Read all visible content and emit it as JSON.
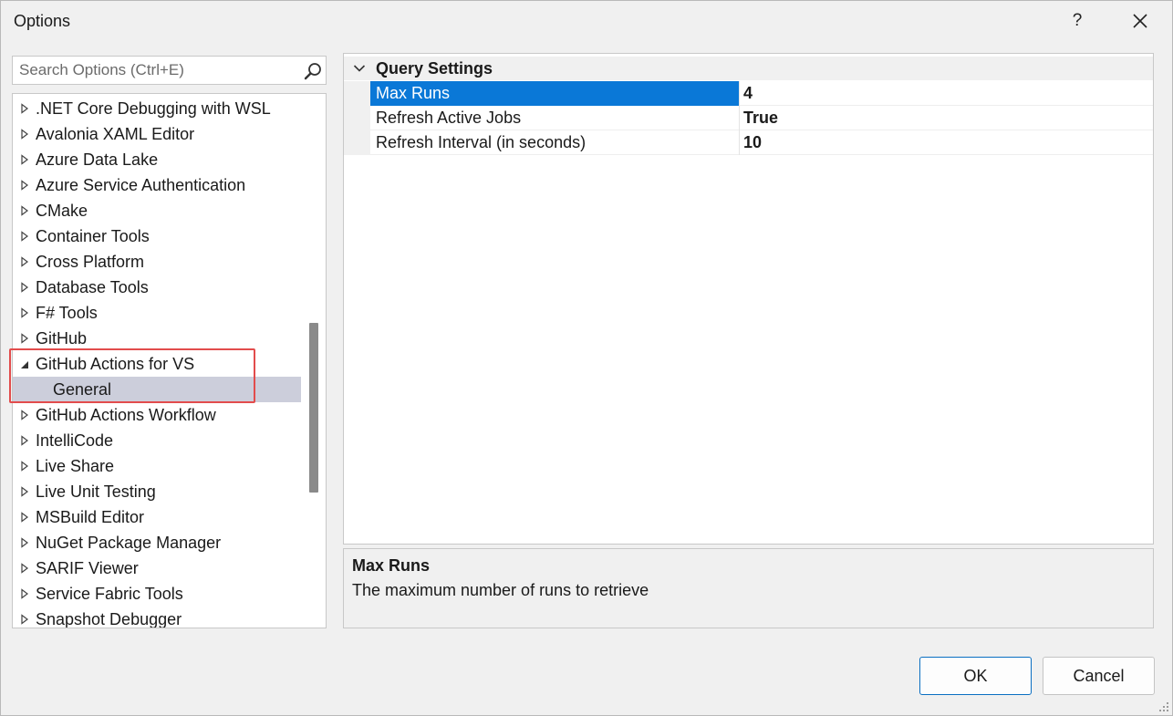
{
  "window": {
    "title": "Options",
    "help_glyph": "?"
  },
  "search": {
    "placeholder": "Search Options (Ctrl+E)"
  },
  "tree": {
    "items": [
      {
        "label": ".NET Core Debugging with WSL",
        "state": "collapsed"
      },
      {
        "label": "Avalonia XAML Editor",
        "state": "collapsed"
      },
      {
        "label": "Azure Data Lake",
        "state": "collapsed"
      },
      {
        "label": "Azure Service Authentication",
        "state": "collapsed"
      },
      {
        "label": "CMake",
        "state": "collapsed"
      },
      {
        "label": "Container Tools",
        "state": "collapsed"
      },
      {
        "label": "Cross Platform",
        "state": "collapsed"
      },
      {
        "label": "Database Tools",
        "state": "collapsed"
      },
      {
        "label": "F# Tools",
        "state": "collapsed"
      },
      {
        "label": "GitHub",
        "state": "collapsed"
      },
      {
        "label": "GitHub Actions for VS",
        "state": "expanded"
      },
      {
        "label": "General",
        "state": "child-selected"
      },
      {
        "label": "GitHub Actions Workflow",
        "state": "collapsed"
      },
      {
        "label": "IntelliCode",
        "state": "collapsed"
      },
      {
        "label": "Live Share",
        "state": "collapsed"
      },
      {
        "label": "Live Unit Testing",
        "state": "collapsed"
      },
      {
        "label": "MSBuild Editor",
        "state": "collapsed"
      },
      {
        "label": "NuGet Package Manager",
        "state": "collapsed"
      },
      {
        "label": "SARIF Viewer",
        "state": "collapsed"
      },
      {
        "label": "Service Fabric Tools",
        "state": "collapsed"
      },
      {
        "label": "Snapshot Debugger",
        "state": "collapsed"
      }
    ]
  },
  "property_grid": {
    "category": "Query Settings",
    "rows": [
      {
        "name": "Max Runs",
        "value": "4",
        "selected": true
      },
      {
        "name": "Refresh Active Jobs",
        "value": "True",
        "selected": false
      },
      {
        "name": "Refresh Interval (in seconds)",
        "value": "10",
        "selected": false
      }
    ]
  },
  "description": {
    "title": "Max Runs",
    "text": "The maximum number of runs to retrieve"
  },
  "buttons": {
    "ok": "OK",
    "cancel": "Cancel"
  },
  "colors": {
    "selection_blue": "#0a78d7",
    "tree_selected": "#cccedb",
    "highlight_red": "#e24c4c"
  }
}
